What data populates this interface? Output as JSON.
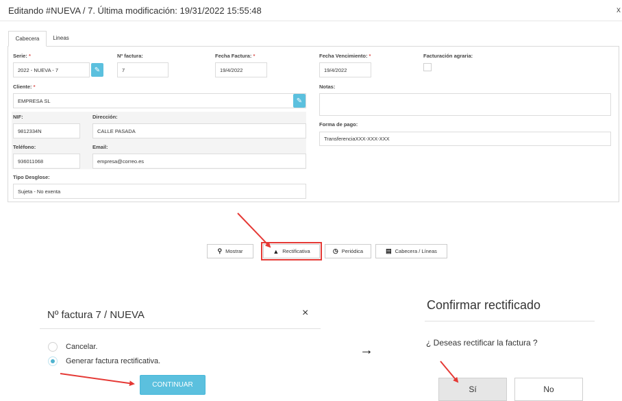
{
  "header": {
    "title": "Editando #NUEVA / 7. Última modificación: 19/31/2022 15:55:48",
    "close": "x"
  },
  "tabs": [
    {
      "label": "Cabecera",
      "active": true
    },
    {
      "label": "Lineas",
      "active": false
    }
  ],
  "form": {
    "serie": {
      "label": "Serie:",
      "required": "*",
      "value": "2022 - NUEVA - 7"
    },
    "nfactura": {
      "label": "Nº factura:",
      "value": "7"
    },
    "fecha_factura": {
      "label": "Fecha Factura:",
      "required": "*",
      "value": "19/4/2022"
    },
    "fecha_vencimiento": {
      "label": "Fecha Vencimiento:",
      "required": "*",
      "value": "19/4/2022"
    },
    "facturacion_agraria": {
      "label": "Facturación agraria:",
      "checked": false
    },
    "cliente": {
      "label": "Cliente:",
      "required": "*",
      "value": "EMPRESA SL"
    },
    "notas": {
      "label": "Notas:",
      "value": ""
    },
    "nif": {
      "label": "NIF:",
      "value": "9812334N"
    },
    "direccion": {
      "label": "Dirección:",
      "value": "CALLE PASADA"
    },
    "forma_pago": {
      "label": "Forma de pago:",
      "value": "TransferenciaXXX-XXX-XXX"
    },
    "telefono": {
      "label": "Teléfono:",
      "value": "936011068"
    },
    "email": {
      "label": "Email:",
      "value": "empresa@correo.es"
    },
    "tipo_desglose": {
      "label": "Tipo Desglose:",
      "value": "Sujeta - No exenta"
    }
  },
  "toolbar": {
    "mostrar": "Mostrar",
    "rectificativa": "Rectificativa",
    "periodica": "Periódica",
    "cabecera_lineas": "Cabecera / Líneas"
  },
  "modal_invoice": {
    "title": "Nº factura 7 / NUEVA",
    "close": "×",
    "options": [
      {
        "label": "Cancelar.",
        "selected": false
      },
      {
        "label": "Generar factura rectificativa.",
        "selected": true
      }
    ],
    "continue_label": "CONTINUAR"
  },
  "flow_arrow": "→",
  "modal_confirm": {
    "title": "Confirmar rectificado",
    "question": "¿ Deseas rectificar la factura ?",
    "yes_label": "Sí",
    "no_label": "No"
  },
  "colors": {
    "accent": "#5bc0de",
    "annotation": "#e53935",
    "required": "#d9534f"
  }
}
